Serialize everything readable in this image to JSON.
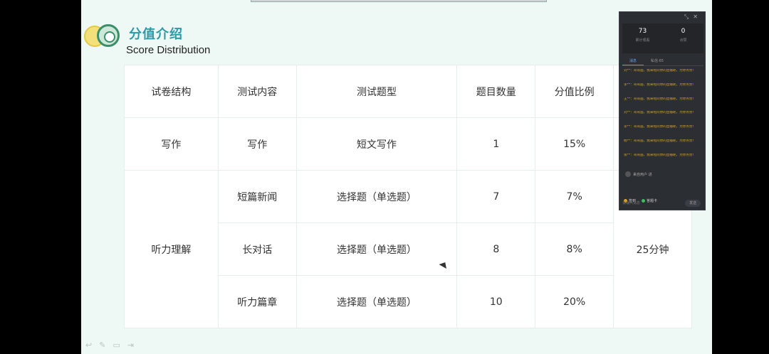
{
  "slide": {
    "title_cn": "分值介绍",
    "title_en": "Score Distribution"
  },
  "table": {
    "headers": [
      "试卷结构",
      "测试内容",
      "测试题型",
      "题目数量",
      "分值比例"
    ],
    "writing": {
      "section": "写作",
      "content": "写作",
      "type": "短文写作",
      "count": "1",
      "ratio": "15%"
    },
    "listening": {
      "section": "听力理解",
      "time": "25分钟",
      "rows": [
        {
          "content": "短篇新闻",
          "type": "选择题（单选题）",
          "count": "7",
          "ratio": "7%"
        },
        {
          "content": "长对话",
          "type": "选择题（单选题）",
          "count": "8",
          "ratio": "8%"
        },
        {
          "content": "听力篇章",
          "type": "选择题（单选题）",
          "count": "10",
          "ratio": "20%"
        }
      ]
    }
  },
  "panel": {
    "stats": [
      {
        "num": "73",
        "label": "累计观看"
      },
      {
        "num": "0",
        "label": "点赞"
      }
    ],
    "tabs": [
      "消息",
      "私信·65"
    ],
    "messages": [
      "刘**：哥哥画，我来啦问你的直播呢，为你点赞！",
      "李**：哥哥画，我来啦问你的直播呢，为你点赞！",
      "王**：哥哥画，我来啦问你的直播呢，为你点赞！",
      "刘**：哥哥画，我来啦问你的直播呢，为你点赞！",
      "李**：哥哥画，我来啦问你的直播呢，为你点赞！",
      "杨**：哥哥画，我来啦问你的直播呢，为你点赞！",
      "张**：哥哥画，我来啦问你的直播呢，为你点赞！"
    ],
    "user_line": "来自用户 进",
    "badges": [
      "签到",
      "答题卡"
    ],
    "input_placeholder": "请输入消息",
    "send_label": "发送"
  },
  "bottom_tools": [
    "↩",
    "✎",
    "▭",
    "⇥"
  ],
  "colors": {
    "title": "#2d9aa8",
    "slide_bg": "#eef8f4",
    "panel_bg": "#2b2e33",
    "message": "#d4a11e",
    "badge_sign": "#f0a020",
    "badge_card": "#3bbf5a"
  }
}
